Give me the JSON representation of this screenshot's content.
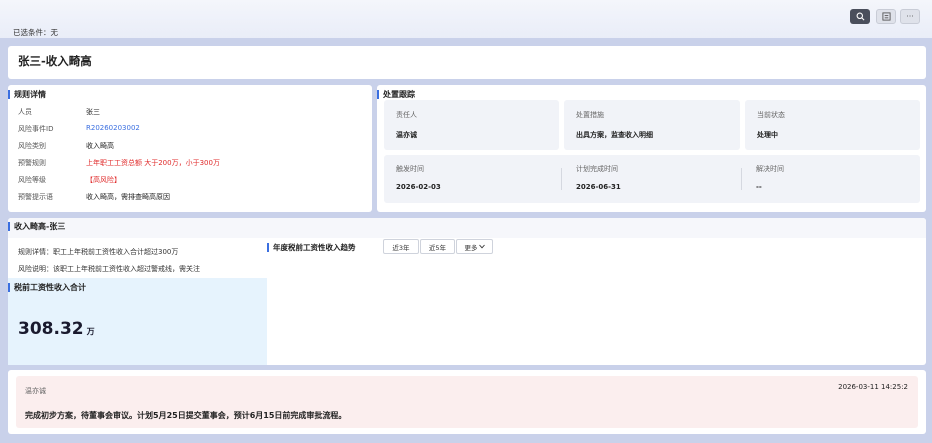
{
  "toolbar": {
    "filter_text": "已选条件：无",
    "more_label": "···"
  },
  "page": {
    "title": "张三-收入畸高"
  },
  "rule_details": {
    "heading": "规则详情",
    "rows": [
      {
        "label": "人员",
        "value": "张三"
      },
      {
        "label": "风险事件ID",
        "value": "R20260203002"
      },
      {
        "label": "风险类别",
        "value": "收入畸高"
      },
      {
        "label": "预警规则",
        "value": "上年职工工资总额 大于200万，小于300万"
      },
      {
        "label": "风险等级",
        "value": "【高风险】"
      },
      {
        "label": "预警提示语",
        "value": "收入畸高，需排查畸高原因"
      }
    ]
  },
  "tracking": {
    "heading": "处置跟踪",
    "responsible_label": "责任人",
    "responsible_value": "温亦诚",
    "measure_label": "处置措施",
    "measure_value": "出具方案，监查收入明细",
    "status_label": "当前状态",
    "status_value": "处理中",
    "trigger_label": "触发时间",
    "trigger_value": "2026-02-03",
    "plan_label": "计划完成时间",
    "plan_value": "2026-06-31",
    "resolve_label": "解决时间",
    "resolve_value": "--"
  },
  "detail": {
    "heading": "收入畸高-张三",
    "rule_desc": "规则详情：职工上年税前工资性收入合计超过300万",
    "risk_desc": "风险说明：该职工上年税前工资性收入超过警戒线，需关注",
    "sum_heading": "税前工资性收入合计",
    "sum_value": "308.32",
    "sum_unit": "万",
    "trend_heading": "年度税前工资性收入趋势",
    "range_buttons": [
      "近3年",
      "近5年",
      "更多"
    ]
  },
  "comment": {
    "author": "温亦诚",
    "time": "2026-03-11 14:25:2",
    "body": "完成初步方案，待董事会审议。计划5月25日提交董事会，预计6月15日前完成审批流程。"
  },
  "colors": {
    "accent": "#3b6fe0",
    "danger": "#e02b2b",
    "page_bg": "#c9d1ea"
  }
}
